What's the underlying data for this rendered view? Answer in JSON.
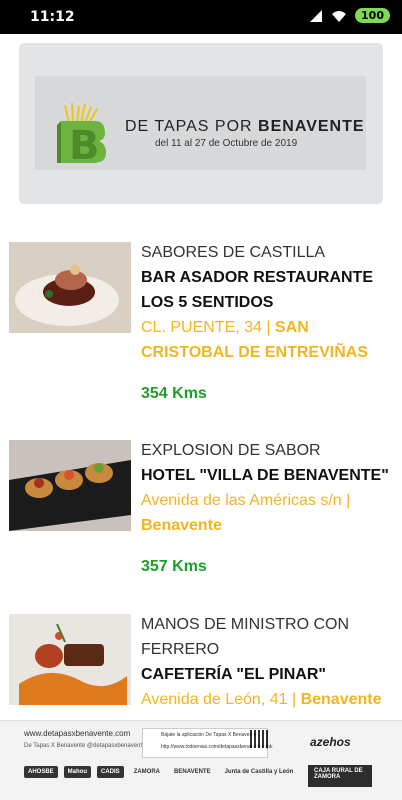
{
  "status_bar": {
    "time": "11:12",
    "battery": "100"
  },
  "banner": {
    "title_prefix": "DE TAPAS POR",
    "title_town": "BENAVENTE",
    "dates": "del 11 al 27 de Octubre de 2019",
    "logo_letter": "B"
  },
  "items": [
    {
      "category": "SABORES DE CASTILLA",
      "name": "BAR ASADOR RESTAURANTE LOS 5 SENTIDOS",
      "address": "CL. PUENTE, 34 |",
      "city": "SAN CRISTOBAL DE ENTREVIÑAS",
      "distance": "354 Kms"
    },
    {
      "category": "EXPLOSION DE SABOR",
      "name": "HOTEL \"VILLA DE BENAVENTE\"",
      "address": "Avenida de las Américas s/n |",
      "city": "Benavente",
      "distance": "357 Kms"
    },
    {
      "category": "MANOS DE MINISTRO CON FERRERO",
      "name": "CAFETERÍA \"EL PINAR\"",
      "address": "Avenida de León, 41 |",
      "city": "Benavente",
      "distance": ""
    }
  ],
  "footer": {
    "website": "www.detapasxbenavente.com",
    "social": "De Tapas X Benavente   @detapasxbenavente",
    "app_text": "Bájate la aplicación De Tapas X Benavente",
    "app_url": "http://www.todoenias.com/detapasxbenavente.apk",
    "sponsor_main": "azehos",
    "logos": [
      "AHOSBE",
      "Mahou",
      "CADIS",
      "ZAMORA",
      "BENAVENTE",
      "Junta de Castilla y León"
    ],
    "caja": "CAJA RURAL DE ZAMORA"
  },
  "colors": {
    "address": "#f2b51f",
    "distance": "#1f9d2b",
    "logo_green": "#6db33f"
  }
}
